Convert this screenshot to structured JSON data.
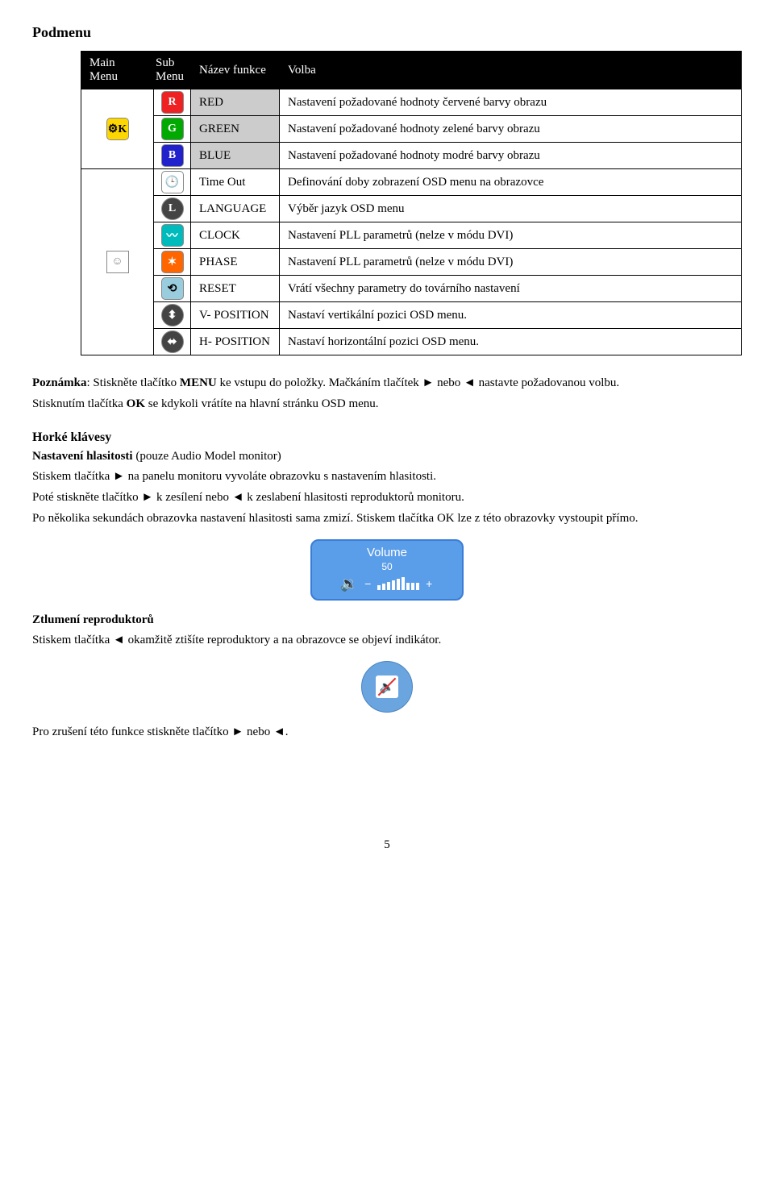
{
  "heading": "Podmenu",
  "table": {
    "headers": {
      "main": "Main Menu",
      "sub": "Sub Menu",
      "func": "Název funkce",
      "opt": "Volba"
    },
    "group1_icon": "⚙K",
    "group1": [
      {
        "iconClass": "icon-red",
        "iconLabel": "R",
        "func": "RED",
        "desc": "Nastavení požadované hodnoty červené barvy obrazu"
      },
      {
        "iconClass": "icon-green",
        "iconLabel": "G",
        "func": "GREEN",
        "desc": "Nastavení požadované hodnoty zelené barvy obrazu"
      },
      {
        "iconClass": "icon-blue",
        "iconLabel": "B",
        "func": "BLUE",
        "desc": "Nastavení požadované hodnoty modré barvy obrazu"
      }
    ],
    "group2_icon": "☺",
    "group2": [
      {
        "iconClass": "icon-white",
        "iconLabel": "🕒",
        "func": "Time Out",
        "desc": "Definování doby zobrazení OSD menu na obrazovce"
      },
      {
        "iconClass": "icon-dark",
        "iconLabel": "L",
        "func": "LANGUAGE",
        "desc": "Výběr jazyk OSD menu"
      },
      {
        "iconClass": "icon-teal",
        "iconLabel": "〰",
        "func": "CLOCK",
        "desc": "Nastavení PLL parametrů (nelze v módu DVI)"
      },
      {
        "iconClass": "icon-orange",
        "iconLabel": "✶",
        "func": "PHASE",
        "desc": "Nastavení PLL parametrů (nelze v módu DVI)"
      },
      {
        "iconClass": "icon-light",
        "iconLabel": "⟲",
        "func": "RESET",
        "desc": "Vrátí všechny parametry do továrního nastavení"
      },
      {
        "iconClass": "icon-dark",
        "iconLabel": "⬍",
        "func": "V- POSITION",
        "desc": "Nastaví vertikální pozici OSD menu."
      },
      {
        "iconClass": "icon-dark",
        "iconLabel": "⬌",
        "func": "H- POSITION",
        "desc": "Nastaví horizontální pozici OSD menu."
      }
    ]
  },
  "note": {
    "prefix": "Poznámka",
    "line1_rest": ": Stiskněte tlačítko ",
    "menu_bold": "MENU",
    "line1_rest2": " ke vstupu do položky. Mačkáním tlačítek ► nebo ◄ nastavte požadovanou volbu.",
    "line2_a": "Stisknutím tlačítka ",
    "ok_bold": "OK",
    "line2_b": " se kdykoli vrátíte na hlavní stránku OSD menu."
  },
  "hotkeys": {
    "heading": "Horké klávesy",
    "sub1": "Nastavení hlasitosti",
    "sub1_rest": " (pouze Audio Model monitor)",
    "p1": "Stiskem tlačítka ► na panelu monitoru vyvoláte obrazovku s nastavením hlasitosti.",
    "p2": "Poté stiskněte tlačítko ► k zesílení nebo ◄ k zeslabení hlasitosti reproduktorů monitoru.",
    "p3": "Po několika sekundách obrazovka nastavení hlasitosti sama zmizí. Stiskem tlačítka OK lze z této obrazovky vystoupit přímo."
  },
  "volume": {
    "title": "Volume",
    "value": "50",
    "minus": "−",
    "plus": "+"
  },
  "mute": {
    "heading": "Ztlumení reproduktorů",
    "p1": "Stiskem tlačítka ◄ okamžitě ztišíte reproduktory a na obrazovce se objeví indikátor."
  },
  "cancel": "Pro zrušení této funkce stiskněte tlačítko ► nebo ◄.",
  "page": "5"
}
